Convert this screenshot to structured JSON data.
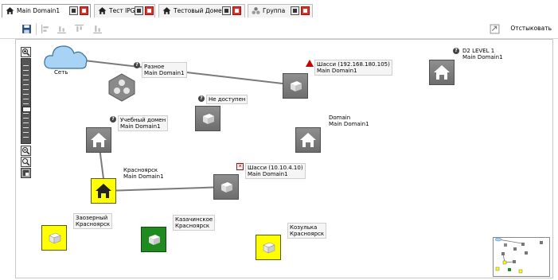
{
  "tabs": [
    {
      "label": "Main Domain1",
      "active": true
    },
    {
      "label": "Тест IPG",
      "active": false
    },
    {
      "label": "Тестовый Домен",
      "active": false
    },
    {
      "label": "Группа",
      "active": false
    }
  ],
  "toolbar": {
    "reset_label": "Отстыковать",
    "tools": [
      "save-icon",
      "align-left-icon",
      "align-bottom-icon",
      "align-top-icon",
      "align-middle-icon"
    ]
  },
  "nodes": {
    "cloud": {
      "label": "Сеть",
      "icon": "cloud-icon"
    },
    "raznoe": {
      "line1": "Разное",
      "line2": "Main Domain1",
      "status": "unknown",
      "icon": "group-icon"
    },
    "ne_dostupen": {
      "line1": "Не доступен",
      "status": "unknown",
      "icon": "server-icon"
    },
    "shassi1": {
      "line1": "Шасси (192.168.180.105)",
      "line2": "Main Domain1",
      "status": "warning",
      "icon": "server-icon"
    },
    "d2level": {
      "line1": "D2 LEVEL 1",
      "line2": "Main Domain1",
      "status": "unknown",
      "icon": "house-icon"
    },
    "uchebny": {
      "line1": "Учебный домен",
      "line2": "Main Domain1",
      "status": "unknown",
      "icon": "house-icon"
    },
    "domain": {
      "line1": "Domain",
      "line2": "Main Domain1",
      "icon": "house-icon"
    },
    "krasnoyarsk": {
      "line1": "Красноярск",
      "line2": "Main Domain1",
      "icon": "house-icon"
    },
    "shassi2": {
      "line1": "Шасси (10.10.4.10)",
      "line2": "Main Domain1",
      "status": "error",
      "icon": "server-icon"
    },
    "zaozerny": {
      "line1": "Заозерный",
      "line2": "Красноярск",
      "icon": "server-icon"
    },
    "kazachinskoe": {
      "line1": "Казачинское",
      "line2": "Красноярск",
      "icon": "server-icon"
    },
    "kozulka": {
      "line1": "Козулька",
      "line2": "Красноярск",
      "icon": "server-icon"
    }
  },
  "status_marks": {
    "unknown": "?",
    "error": "✕"
  },
  "colors": {
    "yellow": "#ffff00",
    "green": "#1f8a1f",
    "gray": "#7a7a7a",
    "warning": "#cc0000"
  }
}
